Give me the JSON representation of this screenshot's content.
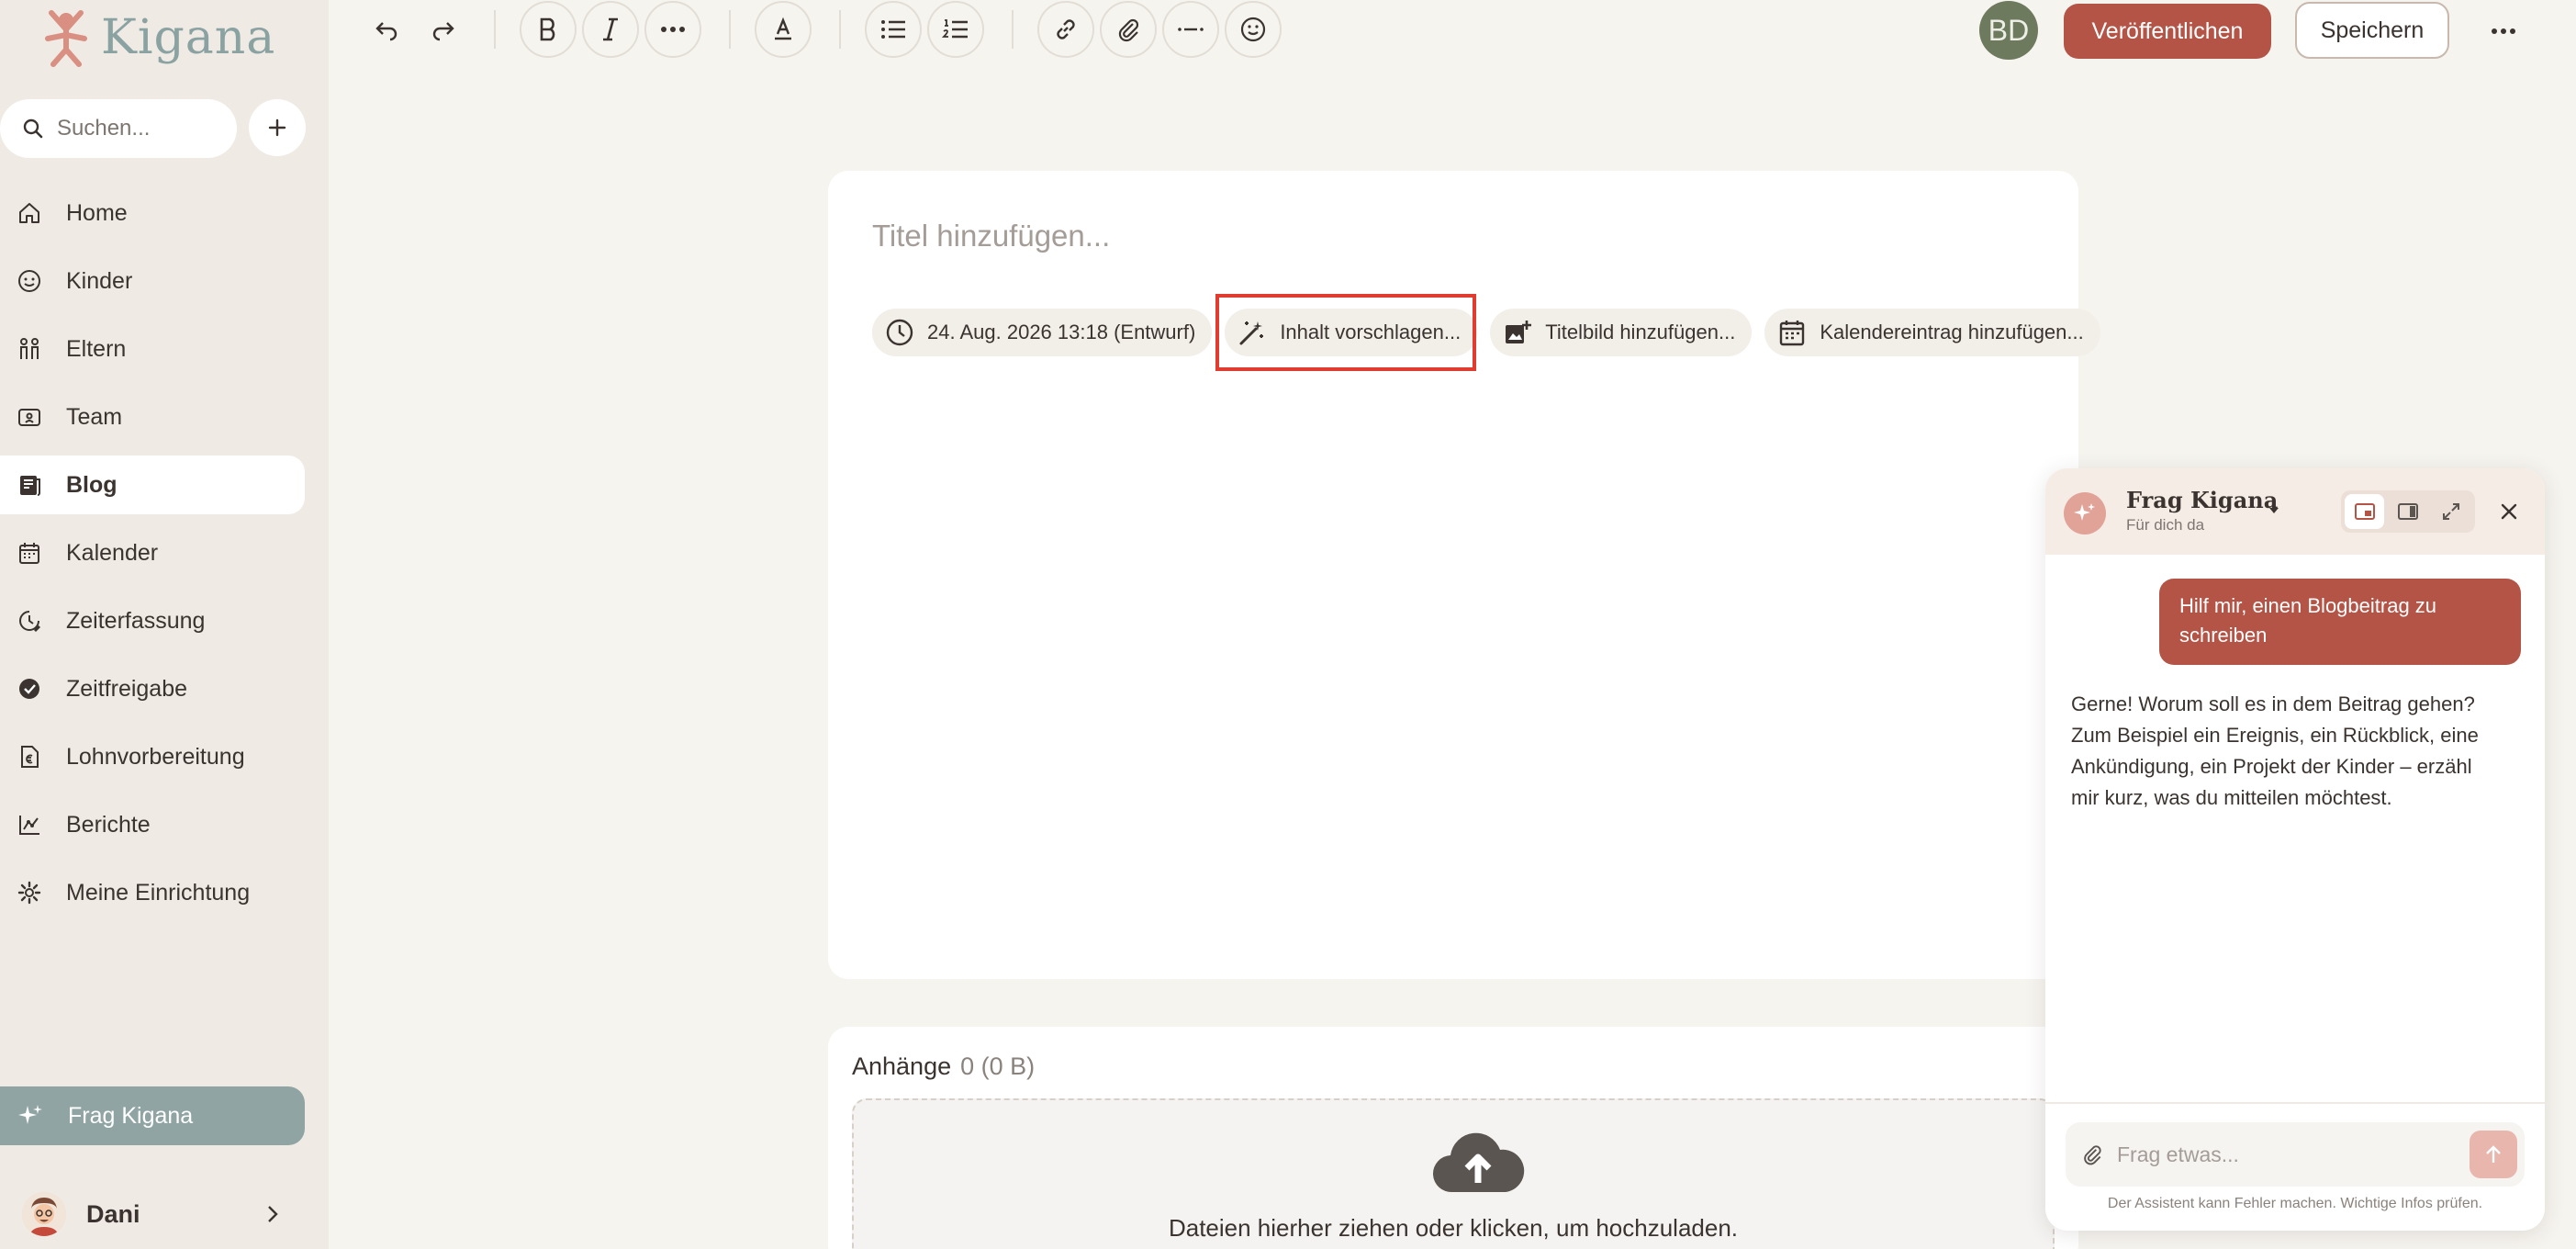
{
  "brand": {
    "name": "Kigana",
    "accent": "#b35446",
    "sage": "#8fa4a3"
  },
  "sidebar": {
    "search_placeholder": "Suchen...",
    "items": [
      {
        "label": "Home",
        "icon": "home-icon"
      },
      {
        "label": "Kinder",
        "icon": "smiley-icon"
      },
      {
        "label": "Eltern",
        "icon": "family-icon"
      },
      {
        "label": "Team",
        "icon": "badge-icon"
      },
      {
        "label": "Blog",
        "icon": "blog-icon",
        "active": true
      },
      {
        "label": "Kalender",
        "icon": "calendar-icon"
      },
      {
        "label": "Zeiterfassung",
        "icon": "clock-icon"
      },
      {
        "label": "Zeitfreigabe",
        "icon": "check-circle-icon"
      },
      {
        "label": "Lohnvorbereitung",
        "icon": "document-euro-icon"
      },
      {
        "label": "Berichte",
        "icon": "chart-icon"
      },
      {
        "label": "Meine Einrichtung",
        "icon": "gear-icon"
      }
    ],
    "assistant_label": "Frag Kigana",
    "user_name": "Dani"
  },
  "header": {
    "avatar_initials": "BD",
    "publish_label": "Veröffentlichen",
    "save_label": "Speichern"
  },
  "editor": {
    "title_placeholder": "Titel hinzufügen...",
    "chips": {
      "date": "24. Aug. 2026 13:18 (Entwurf)",
      "suggest": "Inhalt vorschlagen...",
      "cover": "Titelbild hinzufügen...",
      "calendar": "Kalendereintrag hinzufügen..."
    }
  },
  "attachments": {
    "title": "Anhänge",
    "count": "0 (0 B)",
    "drop_text": "Dateien hierher ziehen oder klicken, um hochzuladen."
  },
  "chat": {
    "title": "Frag Kigana",
    "subtitle": "Für dich da",
    "user_message": "Hilf mir, einen Blogbeitrag zu schreiben",
    "bot_message": "Gerne! Worum soll es in dem Beitrag gehen? Zum Beispiel ein Ereignis, ein Rückblick, eine Ankündigung, ein Projekt der Kinder – erzähl mir kurz, was du mitteilen möchtest.",
    "input_placeholder": "Frag etwas...",
    "disclaimer": "Der Assistent kann Fehler machen. Wichtige Infos prüfen."
  }
}
